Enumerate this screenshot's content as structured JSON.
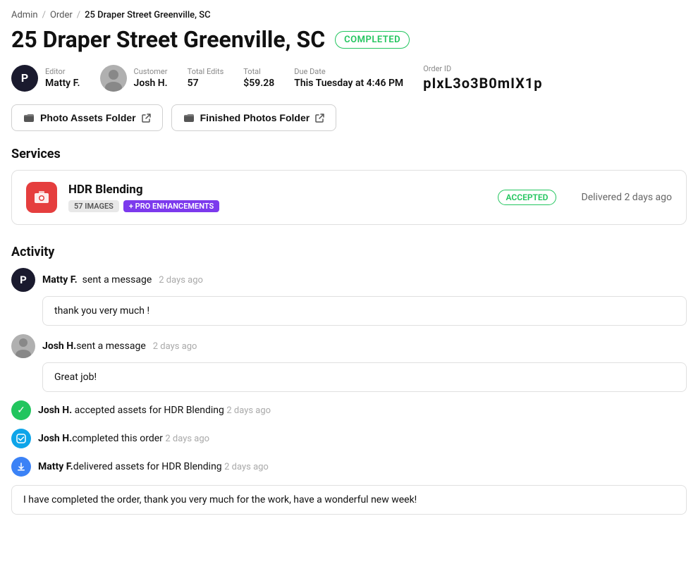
{
  "breadcrumb": {
    "admin": "Admin",
    "order": "Order",
    "current": "25 Draper Street  Greenville, SC",
    "sep": "/"
  },
  "header": {
    "title": "25 Draper Street  Greenville, SC",
    "status": "COMPLETED"
  },
  "meta": {
    "editor_label": "Editor",
    "editor_name": "Matty F.",
    "customer_label": "Customer",
    "customer_name": "Josh H.",
    "total_edits_label": "Total Edits",
    "total_edits_value": "57",
    "total_label": "Total",
    "total_value": "$59.28",
    "due_date_label": "Due Date",
    "due_date_value": "This Tuesday at 4:46 PM",
    "order_id_label": "Order ID",
    "order_id_value": "pIxL3o3B0mIX1p"
  },
  "folders": {
    "photo_assets": "Photo Assets Folder",
    "finished_photos": "Finished Photos Folder"
  },
  "services": {
    "section_title": "Services",
    "service_name": "HDR Blending",
    "tag_images": "57 IMAGES",
    "tag_pro": "+ PRO ENHANCEMENTS",
    "status": "ACCEPTED",
    "delivered": "Delivered 2 days ago"
  },
  "activity": {
    "section_title": "Activity",
    "messages": [
      {
        "sender": "Matty F.",
        "action": "sent a message",
        "time": "2 days ago",
        "text": "thank you very much !",
        "type": "message",
        "avatar_type": "editor"
      },
      {
        "sender": "Josh H.",
        "action": "sent a message",
        "time": "2 days ago",
        "text": "Great job!",
        "type": "message",
        "avatar_type": "customer"
      }
    ],
    "events": [
      {
        "sender": "Josh H.",
        "action": "accepted assets for HDR Blending",
        "time": "2 days ago",
        "icon_type": "check-green"
      },
      {
        "sender": "Josh H.",
        "action": "completed this order",
        "time": "2 days ago",
        "icon_type": "check-teal"
      },
      {
        "sender": "Matty F.",
        "action": "delivered assets for HDR Blending",
        "time": "2 days ago",
        "icon_type": "upload-blue",
        "text": "I have completed the order, thank you very much for the work, have a wonderful new week!"
      }
    ]
  }
}
